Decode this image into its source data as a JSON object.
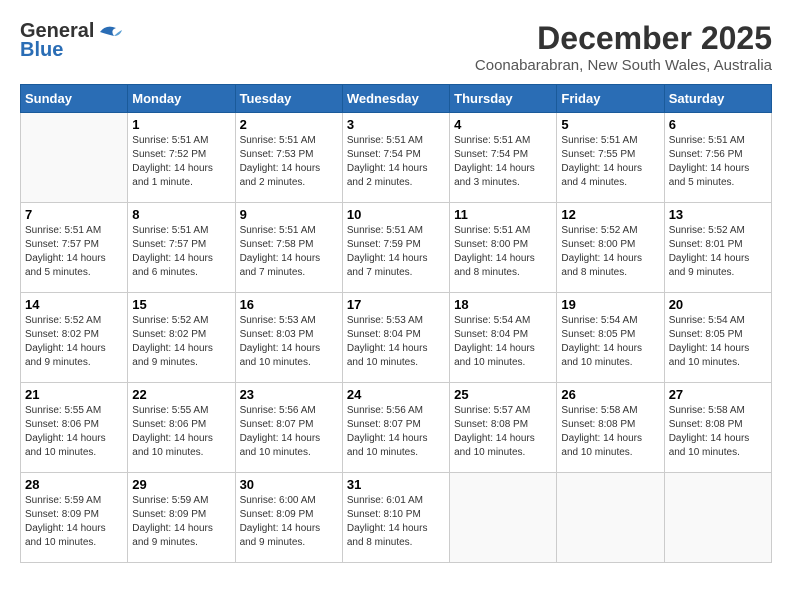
{
  "logo": {
    "general": "General",
    "blue": "Blue"
  },
  "title": "December 2025",
  "subtitle": "Coonabarabran, New South Wales, Australia",
  "weekdays": [
    "Sunday",
    "Monday",
    "Tuesday",
    "Wednesday",
    "Thursday",
    "Friday",
    "Saturday"
  ],
  "weeks": [
    [
      {
        "day": "",
        "info": ""
      },
      {
        "day": "1",
        "info": "Sunrise: 5:51 AM\nSunset: 7:52 PM\nDaylight: 14 hours\nand 1 minute."
      },
      {
        "day": "2",
        "info": "Sunrise: 5:51 AM\nSunset: 7:53 PM\nDaylight: 14 hours\nand 2 minutes."
      },
      {
        "day": "3",
        "info": "Sunrise: 5:51 AM\nSunset: 7:54 PM\nDaylight: 14 hours\nand 2 minutes."
      },
      {
        "day": "4",
        "info": "Sunrise: 5:51 AM\nSunset: 7:54 PM\nDaylight: 14 hours\nand 3 minutes."
      },
      {
        "day": "5",
        "info": "Sunrise: 5:51 AM\nSunset: 7:55 PM\nDaylight: 14 hours\nand 4 minutes."
      },
      {
        "day": "6",
        "info": "Sunrise: 5:51 AM\nSunset: 7:56 PM\nDaylight: 14 hours\nand 5 minutes."
      }
    ],
    [
      {
        "day": "7",
        "info": "Sunrise: 5:51 AM\nSunset: 7:57 PM\nDaylight: 14 hours\nand 5 minutes."
      },
      {
        "day": "8",
        "info": "Sunrise: 5:51 AM\nSunset: 7:57 PM\nDaylight: 14 hours\nand 6 minutes."
      },
      {
        "day": "9",
        "info": "Sunrise: 5:51 AM\nSunset: 7:58 PM\nDaylight: 14 hours\nand 7 minutes."
      },
      {
        "day": "10",
        "info": "Sunrise: 5:51 AM\nSunset: 7:59 PM\nDaylight: 14 hours\nand 7 minutes."
      },
      {
        "day": "11",
        "info": "Sunrise: 5:51 AM\nSunset: 8:00 PM\nDaylight: 14 hours\nand 8 minutes."
      },
      {
        "day": "12",
        "info": "Sunrise: 5:52 AM\nSunset: 8:00 PM\nDaylight: 14 hours\nand 8 minutes."
      },
      {
        "day": "13",
        "info": "Sunrise: 5:52 AM\nSunset: 8:01 PM\nDaylight: 14 hours\nand 9 minutes."
      }
    ],
    [
      {
        "day": "14",
        "info": "Sunrise: 5:52 AM\nSunset: 8:02 PM\nDaylight: 14 hours\nand 9 minutes."
      },
      {
        "day": "15",
        "info": "Sunrise: 5:52 AM\nSunset: 8:02 PM\nDaylight: 14 hours\nand 9 minutes."
      },
      {
        "day": "16",
        "info": "Sunrise: 5:53 AM\nSunset: 8:03 PM\nDaylight: 14 hours\nand 10 minutes."
      },
      {
        "day": "17",
        "info": "Sunrise: 5:53 AM\nSunset: 8:04 PM\nDaylight: 14 hours\nand 10 minutes."
      },
      {
        "day": "18",
        "info": "Sunrise: 5:54 AM\nSunset: 8:04 PM\nDaylight: 14 hours\nand 10 minutes."
      },
      {
        "day": "19",
        "info": "Sunrise: 5:54 AM\nSunset: 8:05 PM\nDaylight: 14 hours\nand 10 minutes."
      },
      {
        "day": "20",
        "info": "Sunrise: 5:54 AM\nSunset: 8:05 PM\nDaylight: 14 hours\nand 10 minutes."
      }
    ],
    [
      {
        "day": "21",
        "info": "Sunrise: 5:55 AM\nSunset: 8:06 PM\nDaylight: 14 hours\nand 10 minutes."
      },
      {
        "day": "22",
        "info": "Sunrise: 5:55 AM\nSunset: 8:06 PM\nDaylight: 14 hours\nand 10 minutes."
      },
      {
        "day": "23",
        "info": "Sunrise: 5:56 AM\nSunset: 8:07 PM\nDaylight: 14 hours\nand 10 minutes."
      },
      {
        "day": "24",
        "info": "Sunrise: 5:56 AM\nSunset: 8:07 PM\nDaylight: 14 hours\nand 10 minutes."
      },
      {
        "day": "25",
        "info": "Sunrise: 5:57 AM\nSunset: 8:08 PM\nDaylight: 14 hours\nand 10 minutes."
      },
      {
        "day": "26",
        "info": "Sunrise: 5:58 AM\nSunset: 8:08 PM\nDaylight: 14 hours\nand 10 minutes."
      },
      {
        "day": "27",
        "info": "Sunrise: 5:58 AM\nSunset: 8:08 PM\nDaylight: 14 hours\nand 10 minutes."
      }
    ],
    [
      {
        "day": "28",
        "info": "Sunrise: 5:59 AM\nSunset: 8:09 PM\nDaylight: 14 hours\nand 10 minutes."
      },
      {
        "day": "29",
        "info": "Sunrise: 5:59 AM\nSunset: 8:09 PM\nDaylight: 14 hours\nand 9 minutes."
      },
      {
        "day": "30",
        "info": "Sunrise: 6:00 AM\nSunset: 8:09 PM\nDaylight: 14 hours\nand 9 minutes."
      },
      {
        "day": "31",
        "info": "Sunrise: 6:01 AM\nSunset: 8:10 PM\nDaylight: 14 hours\nand 8 minutes."
      },
      {
        "day": "",
        "info": ""
      },
      {
        "day": "",
        "info": ""
      },
      {
        "day": "",
        "info": ""
      }
    ]
  ]
}
